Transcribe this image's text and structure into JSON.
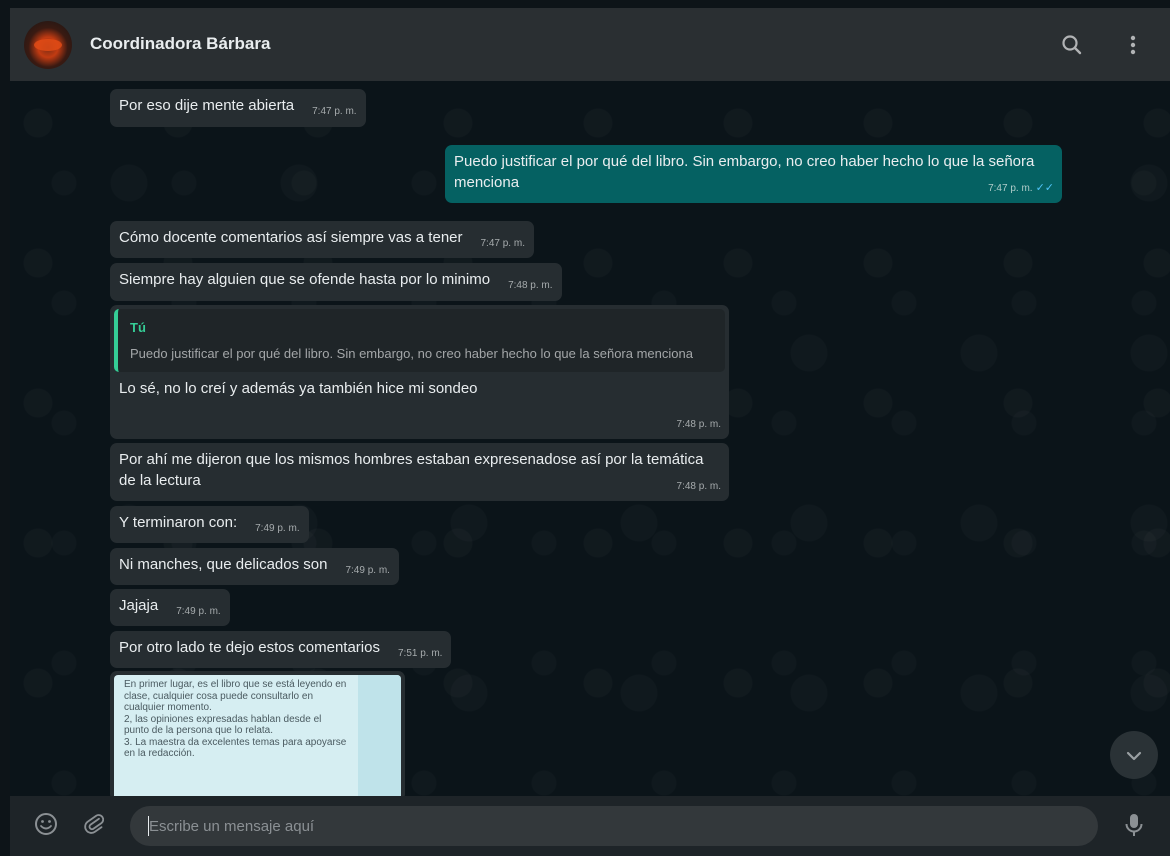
{
  "header": {
    "contact_name": "Coordinadora Bárbara",
    "icons": [
      "avatar",
      "search-icon",
      "menu-icon"
    ]
  },
  "messages": [
    {
      "dir": "in",
      "text": "Por eso dije mente abierta",
      "time": "7:47 p. m."
    },
    {
      "dir": "out",
      "text": "Puedo justificar el por qué del libro. Sin embargo, no creo haber hecho lo que la señora menciona",
      "time": "7:47 p. m.",
      "status": "read"
    },
    {
      "dir": "in",
      "text": "Cómo docente comentarios así siempre vas a tener",
      "time": "7:47 p. m."
    },
    {
      "dir": "in",
      "text": "Siempre hay alguien que se ofende hasta por lo minimo",
      "time": "7:48 p. m."
    },
    {
      "dir": "in",
      "quote_author": "Tú",
      "quote_text": "Puedo justificar el por qué del libro. Sin embargo, no creo haber hecho lo que la señora menciona",
      "text": "Lo sé, no lo creí y además ya también hice mi sondeo",
      "time": "7:48 p. m."
    },
    {
      "dir": "in",
      "text": "Por ahí me dijeron que los mismos hombres estaban expresenadose así por la temática de la lectura",
      "time": "7:48 p. m."
    },
    {
      "dir": "in",
      "text": "Y terminaron con:",
      "time": "7:49 p. m."
    },
    {
      "dir": "in",
      "text": "Ni manches, que delicados son",
      "time": "7:49 p. m."
    },
    {
      "dir": "in",
      "text": "Jajaja",
      "time": "7:49 p. m."
    },
    {
      "dir": "in",
      "text": "Por otro lado te dejo estos comentarios",
      "time": "7:51 p. m."
    }
  ],
  "image_message": {
    "text": "En primer lugar, es el libro que se está leyendo en clase, cualquier cosa puede consultarlo en cualquier momento.\n2, las opiniones expresadas hablan desde el punto de la persona que lo relata.\n3. La maestra da excelentes temas para apoyarse en la redacción."
  },
  "composer": {
    "placeholder": "Escribe un mensaje aquí",
    "value": ""
  },
  "colors": {
    "incoming_bubble": "#262d31",
    "outgoing_bubble": "#056162",
    "quote_accent": "#35cd96",
    "read_ticks": "#4fc3f7"
  }
}
